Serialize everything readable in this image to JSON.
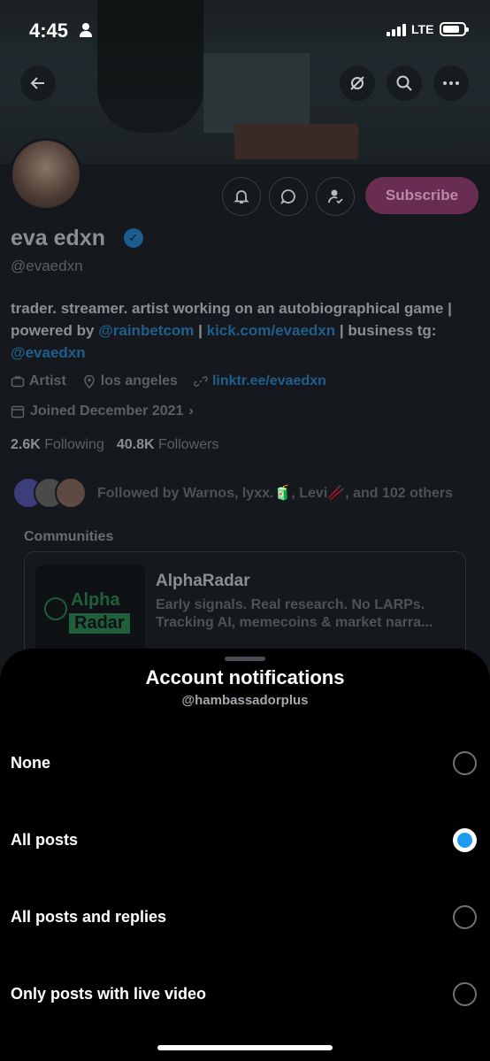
{
  "status_bar": {
    "time": "4:45",
    "network": "LTE"
  },
  "profile": {
    "name": "eva edxn",
    "handle": "@evaedxn",
    "subscribe_label": "Subscribe",
    "bio": {
      "part1": "trader. streamer. artist working on an autobiographical game | powered by ",
      "link1": "@rainbetcom",
      "sep1": " | ",
      "link2": "kick.com/evaedxn",
      "sep2": " | business tg: ",
      "link3": "@evaedxn"
    },
    "category": "Artist",
    "location": "los angeles",
    "website": "linktr.ee/evaedxn",
    "joined": "Joined December 2021",
    "following_count": "2.6K",
    "following_label": "Following",
    "followers_count": "40.8K",
    "followers_label": "Followers",
    "followed_by": "Followed by Warnos, lyxx.🧃, Levi🥢, and 102 others"
  },
  "communities": {
    "title": "Communities",
    "name": "AlphaRadar",
    "logo_word1": "Alpha",
    "logo_word2": "Radar",
    "description": "Early signals. Real research. No LARPs. Tracking AI, memecoins & market narra..."
  },
  "sheet": {
    "title": "Account notifications",
    "subtitle": "@hambassadorplus",
    "options": [
      {
        "label": "None",
        "selected": false
      },
      {
        "label": "All posts",
        "selected": true
      },
      {
        "label": "All posts and replies",
        "selected": false
      },
      {
        "label": "Only posts with live video",
        "selected": false
      }
    ]
  },
  "colors": {
    "accent": "#1d9bf0",
    "subscribe": "#c6357f"
  }
}
